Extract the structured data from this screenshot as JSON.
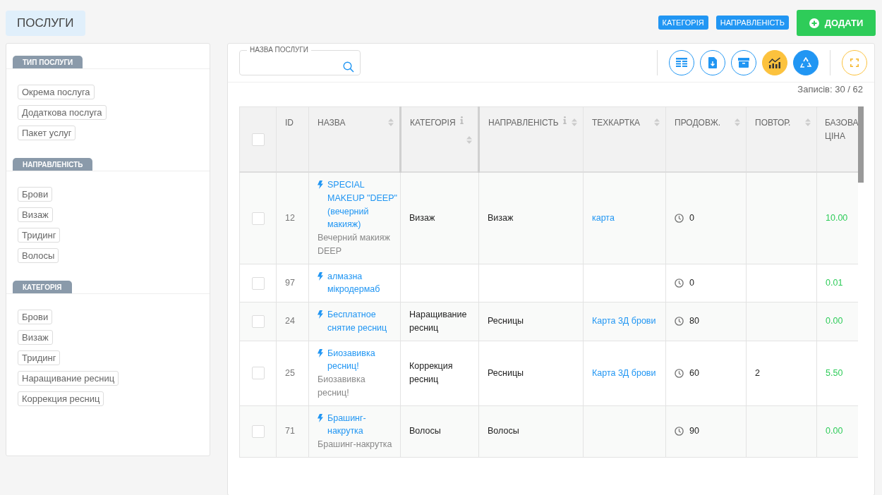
{
  "page_title": "ПОСЛУГИ",
  "header_buttons": [
    {
      "label": "КАТЕГОРІЯ",
      "kind": "tag"
    },
    {
      "label": "НАПРАВЛЕНІСТЬ",
      "kind": "tag"
    },
    {
      "label": "ДОДАТИ",
      "kind": "add"
    }
  ],
  "filters": [
    {
      "title": "ТИП ПОСЛУГИ",
      "items": [
        "Окрема послуга",
        "Додаткова послуга",
        "Пакет услуг"
      ]
    },
    {
      "title": "НАПРАВЛЕНІСТЬ",
      "items": [
        "Брови",
        "Визаж",
        "Тридинг",
        "Волосы"
      ]
    },
    {
      "title": "КАТЕГОРІЯ",
      "items": [
        "Брови",
        "Визаж",
        "Тридинг",
        "Наращивание ресниц",
        "Коррекция ресниц"
      ]
    }
  ],
  "search": {
    "label": "НАЗВА ПОСЛУГИ"
  },
  "toolbar": [
    {
      "kind": "columns"
    },
    {
      "kind": "export"
    },
    {
      "kind": "archive"
    },
    {
      "kind": "chart"
    },
    {
      "kind": "recycle"
    },
    {
      "kind": "fullscreen"
    }
  ],
  "records": "Записів: 30 / 62",
  "table": {
    "select_all": {
      "checked": false
    },
    "columns": [
      {
        "label": "ID",
        "sortable": false,
        "info": false
      },
      {
        "label": "НАЗВА",
        "sortable": true,
        "info": false
      },
      {
        "label": "КАТЕГОРІЯ",
        "sortable": true,
        "info": true
      },
      {
        "label": "НАПРАВЛЕНІСТЬ",
        "sortable": true,
        "info": true
      },
      {
        "label": "ТЕХКАРТКА",
        "sortable": true,
        "info": false
      },
      {
        "label": "ПРОДОВЖ.",
        "sortable": true,
        "info": false
      },
      {
        "label": "ПОВТОР.",
        "sortable": true,
        "info": false
      },
      {
        "label": "БАЗОВА ЦІНА",
        "sortable": false,
        "info": false
      }
    ],
    "rows": [
      {
        "checked": false,
        "id": "12",
        "name": "SPECIAL MAKEUP \"DEEP\" (вечерний макияж)",
        "subtitle": "Вечерний макияж DEEP",
        "category": "Визаж",
        "direction": "Визаж",
        "techcard": "карта",
        "duration": "0",
        "repeat": "",
        "price": "10.00"
      },
      {
        "checked": false,
        "id": "97",
        "name": "алмазна мікродермаб",
        "subtitle": "",
        "category": "",
        "direction": "",
        "techcard": "",
        "duration": "0",
        "repeat": "",
        "price": "0.01"
      },
      {
        "checked": false,
        "id": "24",
        "name": "Бесплатное снятие ресниц",
        "subtitle": "",
        "category": "Наращивание ресниц",
        "direction": "Ресницы",
        "techcard": "Карта 3Д брови",
        "duration": "80",
        "repeat": "",
        "price": "0.00"
      },
      {
        "checked": false,
        "id": "25",
        "name": "Биозавивка ресниц!",
        "subtitle": "Биозавивка ресниц!",
        "category": "Коррекция ресниц",
        "direction": "Ресницы",
        "techcard": "Карта 3Д брови",
        "duration": "60",
        "repeat": "2",
        "price": "5.50"
      },
      {
        "checked": false,
        "id": "71",
        "name": "Брашинг-накрутка",
        "subtitle": "Брашинг-накрутка",
        "category": "Волосы",
        "direction": "Волосы",
        "techcard": "",
        "duration": "90",
        "repeat": "",
        "price": "0.00"
      }
    ]
  }
}
